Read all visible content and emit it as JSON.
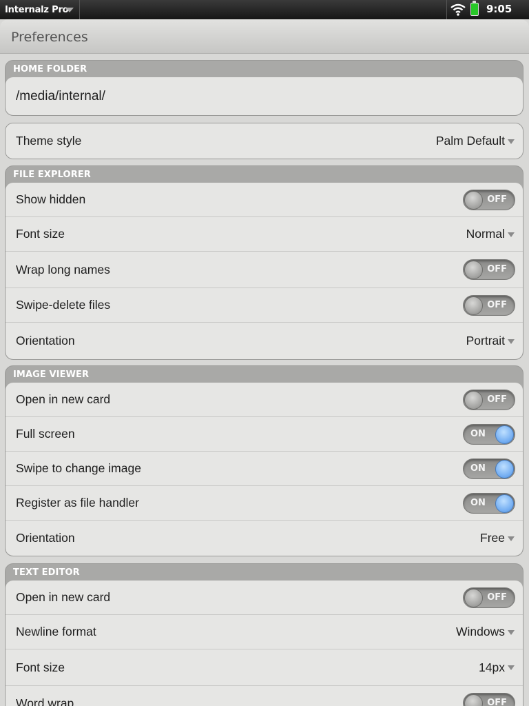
{
  "statusbar": {
    "app_name": "Internalz Pro",
    "time": "9:05",
    "icons": [
      "wifi-icon",
      "battery-icon"
    ],
    "battery_color": "#28c828"
  },
  "header": {
    "title": "Preferences"
  },
  "home_folder": {
    "label": "HOME FOLDER",
    "path": "/media/internal/"
  },
  "theme": {
    "label": "Theme style",
    "value": "Palm Default"
  },
  "file_explorer": {
    "label": "FILE EXPLORER",
    "show_hidden": {
      "label": "Show hidden",
      "state": "OFF"
    },
    "font_size": {
      "label": "Font size",
      "value": "Normal"
    },
    "wrap_long_names": {
      "label": "Wrap long names",
      "state": "OFF"
    },
    "swipe_delete": {
      "label": "Swipe-delete files",
      "state": "OFF"
    },
    "orientation": {
      "label": "Orientation",
      "value": "Portrait"
    }
  },
  "image_viewer": {
    "label": "IMAGE VIEWER",
    "open_new_card": {
      "label": "Open in new card",
      "state": "OFF"
    },
    "full_screen": {
      "label": "Full screen",
      "state": "ON"
    },
    "swipe_change": {
      "label": "Swipe to change image",
      "state": "ON"
    },
    "register_handler": {
      "label": "Register as file handler",
      "state": "ON"
    },
    "orientation": {
      "label": "Orientation",
      "value": "Free"
    }
  },
  "text_editor": {
    "label": "TEXT EDITOR",
    "open_new_card": {
      "label": "Open in new card",
      "state": "OFF"
    },
    "newline_format": {
      "label": "Newline format",
      "value": "Windows"
    },
    "font_size": {
      "label": "Font size",
      "value": "14px"
    },
    "word_wrap": {
      "label": "Word wrap",
      "state": "OFF"
    }
  },
  "colors": {
    "toggle_on": "#74aef2",
    "toggle_off": "#a0a09e",
    "group_header": "#a9a9a7",
    "row_bg": "#e6e6e4"
  }
}
